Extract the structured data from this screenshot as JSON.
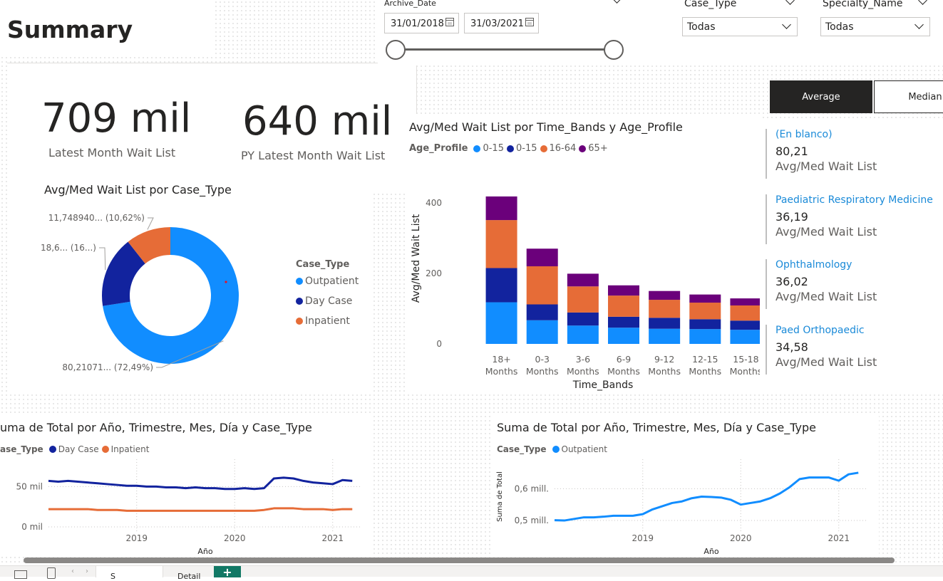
{
  "page": {
    "title": "Summary"
  },
  "slicers": {
    "archive_date": {
      "label": "Archive_Date",
      "from": "31/01/2018",
      "to": "31/03/2021"
    },
    "case_type": {
      "label": "Case_Type",
      "value": "Todas"
    },
    "specialty_name": {
      "label": "Specialty_Name",
      "value": "Todas"
    }
  },
  "kpis": [
    {
      "value": "709 mil",
      "label": "Latest Month Wait List"
    },
    {
      "value": "640 mil",
      "label": "PY Latest Month Wait List"
    }
  ],
  "toggle": {
    "average": "Average",
    "median": "Median",
    "active": "average"
  },
  "cards": [
    {
      "category": "(En blanco)",
      "value": "80,21",
      "label": "Avg/Med Wait List"
    },
    {
      "category": "Paediatric Respiratory Medicine",
      "value": "36,19",
      "label": "Avg/Med Wait List"
    },
    {
      "category": "Ophthalmology",
      "value": "36,02",
      "label": "Avg/Med Wait List"
    },
    {
      "category": "Paed Orthopaedic",
      "value": "34,58",
      "label": "Avg/Med Wait List"
    }
  ],
  "donut": {
    "title": "Avg/Med Wait List por Case_Type",
    "legend_title": "Case_Type",
    "slice_labels": [
      "80,21071... (72,49%)",
      "18,6... (16...)",
      "11,748940... (10,62%)"
    ]
  },
  "bar": {
    "title": "Avg/Med Wait List por Time_Bands y Age_Profile",
    "legend_title": "Age_Profile",
    "xlabel": "Time_Bands",
    "ylabel": "Avg/Med Wait List",
    "yticks": [
      "0",
      "200",
      "400"
    ]
  },
  "line1": {
    "title": "uma de Total por Año, Trimestre, Mes, Día y Case_Type",
    "legend_title": "ase_Type",
    "xlabel": "Año",
    "yticks": [
      "0 mil",
      "50 mil"
    ],
    "xticks": [
      "2019",
      "2020",
      "2021"
    ]
  },
  "line2": {
    "title": "Suma de Total por Año, Trimestre, Mes, Día y Case_Type",
    "legend_title": "Case_Type",
    "xlabel": "Año",
    "ylabel": "Suma de Total",
    "yticks": [
      "0,5 mill.",
      "0,6 mill."
    ],
    "xticks": [
      "2019",
      "2020",
      "2021"
    ]
  },
  "tabs": [
    {
      "label": "S"
    },
    {
      "label": "Detail"
    },
    {
      "label": "+"
    }
  ],
  "chart_data": [
    {
      "type": "pie",
      "title": "Avg/Med Wait List por Case_Type",
      "categories": [
        "Outpatient",
        "Day Case",
        "Inpatient"
      ],
      "values": [
        80.21071,
        18.6,
        11.74894
      ],
      "percent": [
        72.49,
        16.89,
        10.62
      ],
      "colors": [
        "#118dff",
        "#12239e",
        "#e66c37"
      ],
      "legend": "right"
    },
    {
      "type": "bar",
      "stacked": true,
      "title": "Avg/Med Wait List por Time_Bands y Age_Profile",
      "categories": [
        "18+ Months",
        "0-3 Months",
        "3-6 Months",
        "6-9 Months",
        "9-12 Months",
        "12-15 Months",
        "15-18 Months"
      ],
      "series": [
        {
          "name": "0-15",
          "color": "#118dff",
          "values": [
            118,
            67,
            52,
            46,
            43,
            42,
            40
          ]
        },
        {
          "name": "0-15",
          "color": "#12239e",
          "values": [
            97,
            45,
            37,
            31,
            31,
            28,
            26
          ]
        },
        {
          "name": "16-64",
          "color": "#e66c37",
          "values": [
            136,
            108,
            74,
            60,
            51,
            47,
            43
          ]
        },
        {
          "name": "65+",
          "color": "#6b007b",
          "values": [
            67,
            50,
            36,
            29,
            25,
            23,
            20
          ]
        }
      ],
      "xlabel": "Time_Bands",
      "ylabel": "Avg/Med Wait List",
      "ylim": [
        0,
        440
      ],
      "legend": "top-left"
    },
    {
      "type": "line",
      "title": "uma de Total por Año, Trimestre, Mes, Día y Case_Type",
      "x": [
        2018.1,
        2018.2,
        2018.3,
        2018.4,
        2018.5,
        2018.6,
        2018.7,
        2018.8,
        2018.9,
        2019.0,
        2019.1,
        2019.2,
        2019.3,
        2019.4,
        2019.5,
        2019.6,
        2019.7,
        2019.8,
        2019.9,
        2020.0,
        2020.1,
        2020.2,
        2020.3,
        2020.4,
        2020.5,
        2020.6,
        2020.7,
        2020.8,
        2020.9,
        2021.0,
        2021.1,
        2021.2
      ],
      "series": [
        {
          "name": "Day Case",
          "color": "#12239e",
          "values": [
            57,
            56,
            57,
            56,
            55,
            54,
            53,
            52,
            51,
            51,
            50,
            50,
            49,
            49,
            48,
            49,
            48,
            48,
            47,
            47,
            48,
            47,
            48,
            60,
            61,
            60,
            57,
            55,
            54,
            53,
            58,
            57
          ]
        },
        {
          "name": "Inpatient",
          "color": "#e66c37",
          "values": [
            22,
            22,
            22,
            22,
            22,
            21,
            21,
            21,
            20,
            20,
            20,
            20,
            20,
            20,
            20,
            20,
            20,
            20,
            20,
            20,
            20,
            20,
            21,
            23,
            23,
            23,
            22,
            22,
            22,
            21,
            22,
            22
          ]
        }
      ],
      "xlabel": "Año",
      "ylim": [
        0,
        75
      ],
      "legend": "top-left"
    },
    {
      "type": "line",
      "title": "Suma de Total por Año, Trimestre, Mes, Día y Case_Type",
      "x": [
        2018.1,
        2018.2,
        2018.3,
        2018.4,
        2018.5,
        2018.6,
        2018.7,
        2018.8,
        2018.9,
        2019.0,
        2019.1,
        2019.2,
        2019.3,
        2019.4,
        2019.5,
        2019.6,
        2019.7,
        2019.8,
        2019.9,
        2020.0,
        2020.1,
        2020.2,
        2020.3,
        2020.4,
        2020.5,
        2020.6,
        2020.7,
        2020.8,
        2020.9,
        2021.0,
        2021.1,
        2021.2
      ],
      "series": [
        {
          "name": "Outpatient",
          "color": "#118dff",
          "values": [
            0.501,
            0.5,
            0.505,
            0.51,
            0.51,
            0.512,
            0.515,
            0.515,
            0.515,
            0.52,
            0.535,
            0.545,
            0.555,
            0.56,
            0.57,
            0.575,
            0.574,
            0.572,
            0.565,
            0.55,
            0.555,
            0.56,
            0.57,
            0.585,
            0.605,
            0.63,
            0.635,
            0.635,
            0.635,
            0.625,
            0.645,
            0.65
          ]
        }
      ],
      "xlabel": "Año",
      "ylabel": "Suma de Total",
      "ylim": [
        0.48,
        0.67
      ],
      "legend": "top-left"
    }
  ]
}
